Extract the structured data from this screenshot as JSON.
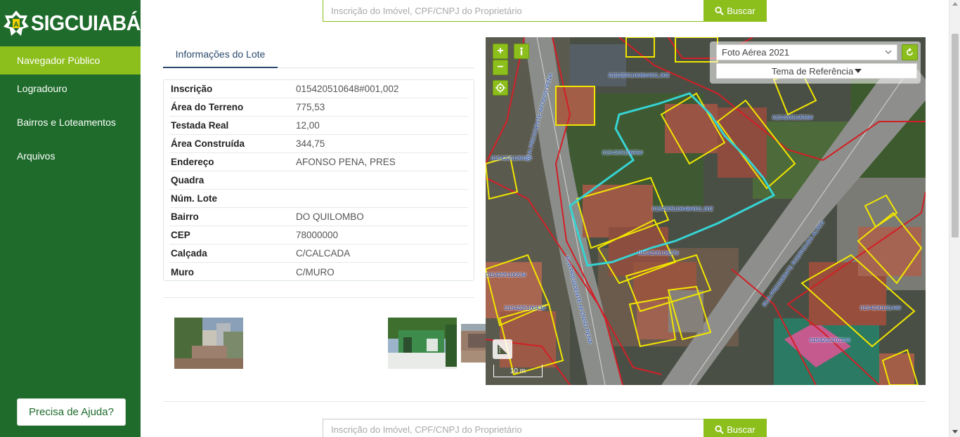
{
  "brand": {
    "name": "SIGCUIABÁ"
  },
  "sidebar": {
    "items": [
      {
        "label": "Navegador Público",
        "active": true
      },
      {
        "label": "Logradouro"
      },
      {
        "label": "Bairros e Loteamentos"
      },
      {
        "label": "Arquivos"
      }
    ],
    "help_label": "Precisa de Ajuda?"
  },
  "search": {
    "placeholder": "Inscrição do Imóvel, CPF/CNPJ do Proprietário",
    "button_label": "Buscar"
  },
  "lote": {
    "tab_label": "Informações do Lote",
    "rows": [
      {
        "label": "Inscrição",
        "value": "015420510648#001,002"
      },
      {
        "label": "Área do Terreno",
        "value": "775,53"
      },
      {
        "label": "Testada Real",
        "value": "12,00"
      },
      {
        "label": "Área Construída",
        "value": "344,75"
      },
      {
        "label": "Endereço",
        "value": "AFONSO PENA, PRES"
      },
      {
        "label": "Quadra",
        "value": ""
      },
      {
        "label": "Núm. Lote",
        "value": ""
      },
      {
        "label": "Bairro",
        "value": "DO QUILOMBO"
      },
      {
        "label": "CEP",
        "value": "78000000"
      },
      {
        "label": "Calçada",
        "value": "C/CALCADA"
      },
      {
        "label": "Muro",
        "value": "C/MURO"
      }
    ]
  },
  "map": {
    "layer_selected": "Foto Aérea 2021",
    "theme_label": "Tema de Referência",
    "scale_label": "10 m",
    "labels": [
      "015420510686#001,002",
      "015420510559#",
      "015420510656#",
      "015420510907#",
      "015420510648#001,002",
      "015420510637#",
      "015420510053#",
      "015420510043#",
      "015420010144#",
      "015420010724#",
      "RUA PRESIDENTE AFONSO PENA",
      "RUA PRESIDENTE AFONSO PENA",
      "RUA PRESIDENTE RODRIGUES ALVES"
    ]
  },
  "colors": {
    "sidebar": "#1e6b2b",
    "accent": "#8cbe1c",
    "selected_lot": "#36d3d3",
    "building_outline": "#f2e600",
    "parcel_outline": "#d21f26"
  }
}
